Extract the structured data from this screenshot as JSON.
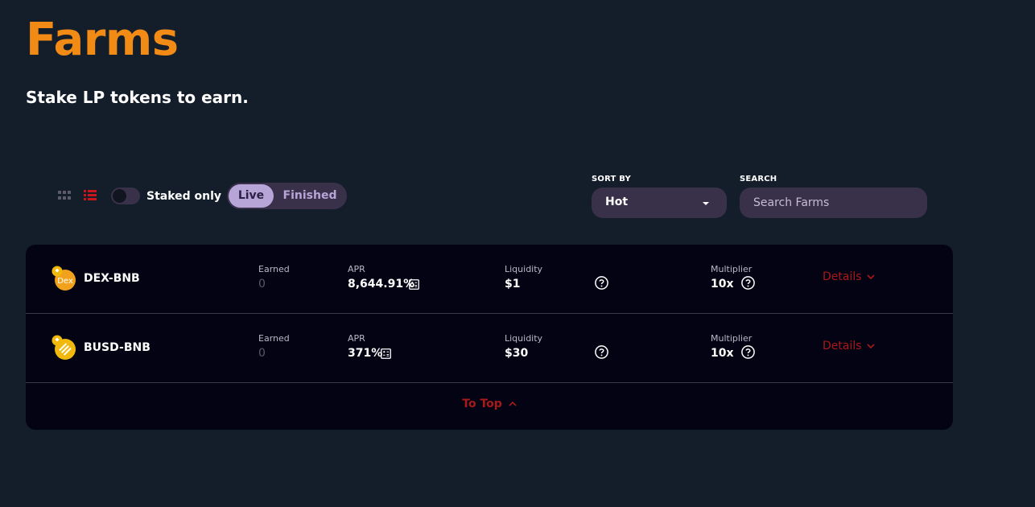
{
  "header": {
    "title": "Farms",
    "subtitle": "Stake LP tokens to earn."
  },
  "controls": {
    "staked_only_label": "Staked only",
    "tabs": [
      "Live",
      "Finished"
    ],
    "sort_label": "SORT BY",
    "sort_value": "Hot",
    "search_label": "SEARCH",
    "search_placeholder": "Search Farms"
  },
  "farms": [
    {
      "pair": "DEX-BNB",
      "earned_label": "Earned",
      "earned": "0",
      "apr_label": "APR",
      "apr": "8,644.91%",
      "liquidity_label": "Liquidity",
      "liquidity": "$1",
      "multiplier_label": "Multiplier",
      "multiplier": "10x",
      "details_label": "Details",
      "token_icon": "dex-token-icon",
      "token_icon_text": "Dex"
    },
    {
      "pair": "BUSD-BNB",
      "earned_label": "Earned",
      "earned": "0",
      "apr_label": "APR",
      "apr": "371%",
      "liquidity_label": "Liquidity",
      "liquidity": "$30",
      "multiplier_label": "Multiplier",
      "multiplier": "10x",
      "details_label": "Details",
      "token_icon": "busd-token-icon"
    }
  ],
  "table": {
    "to_top_label": "To Top"
  },
  "colors": {
    "background": "#141e2b",
    "accent_orange": "#f28b15",
    "panel": "#030313",
    "control_bg": "#39314a",
    "active_tab": "#b8a5d8",
    "link_red": "#a8191a"
  }
}
